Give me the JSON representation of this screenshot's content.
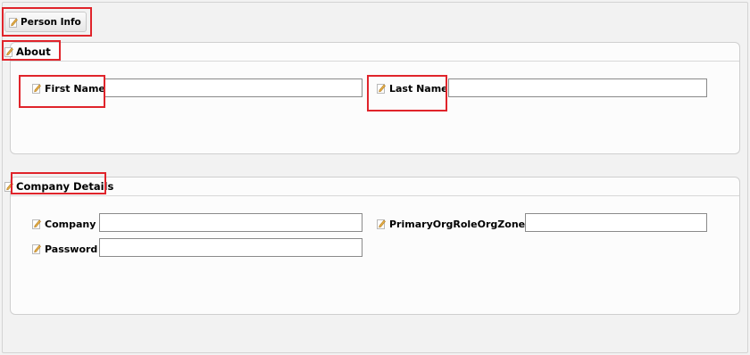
{
  "tab": {
    "label": "Person Info",
    "icon": "pencil-icon"
  },
  "about": {
    "title": "About",
    "first_name": {
      "label": "First Name :",
      "value": ""
    },
    "last_name": {
      "label": "Last Name :",
      "value": ""
    }
  },
  "company_details": {
    "title": "Company Details",
    "company": {
      "label": "Company :",
      "value": ""
    },
    "org_zone": {
      "label": "PrimaryOrgRoleOrgZoneID :",
      "value": ""
    },
    "password": {
      "label": "Password :",
      "value": ""
    }
  },
  "colors": {
    "highlight": "#e0242b",
    "panel_border": "#cfcfcf"
  }
}
